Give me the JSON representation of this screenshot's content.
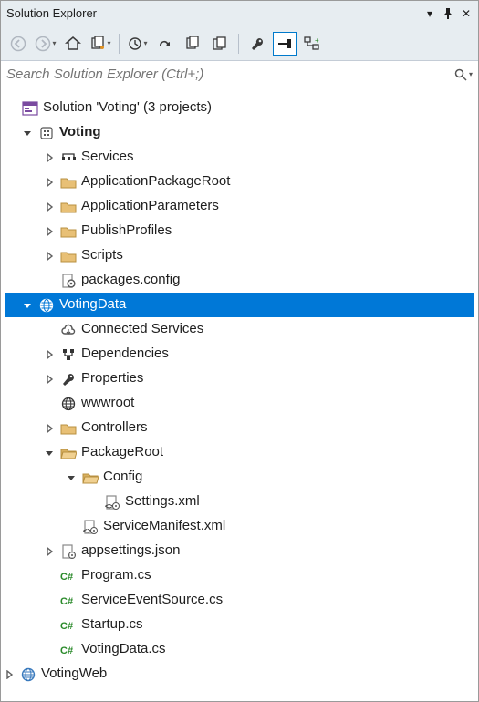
{
  "title": "Solution Explorer",
  "search": {
    "placeholder": "Search Solution Explorer (Ctrl+;)"
  },
  "solution_line": "Solution 'Voting' (3 projects)",
  "nodes": [
    {
      "indent": 0,
      "arrow": "down",
      "icon": "sf-project",
      "label": "Voting",
      "bold": true
    },
    {
      "indent": 24,
      "arrow": "right",
      "icon": "services",
      "label": "Services"
    },
    {
      "indent": 24,
      "arrow": "right",
      "icon": "folder",
      "label": "ApplicationPackageRoot"
    },
    {
      "indent": 24,
      "arrow": "right",
      "icon": "folder",
      "label": "ApplicationParameters"
    },
    {
      "indent": 24,
      "arrow": "right",
      "icon": "folder",
      "label": "PublishProfiles"
    },
    {
      "indent": 24,
      "arrow": "right",
      "icon": "folder",
      "label": "Scripts"
    },
    {
      "indent": 24,
      "arrow": "none",
      "icon": "config",
      "label": "packages.config"
    },
    {
      "indent": 0,
      "arrow": "down",
      "icon": "web-project",
      "label": "VotingData",
      "selected": true
    },
    {
      "indent": 24,
      "arrow": "none",
      "icon": "cloud",
      "label": "Connected Services"
    },
    {
      "indent": 24,
      "arrow": "right",
      "icon": "deps",
      "label": "Dependencies"
    },
    {
      "indent": 24,
      "arrow": "right",
      "icon": "wrench",
      "label": "Properties"
    },
    {
      "indent": 24,
      "arrow": "none",
      "icon": "globe",
      "label": "wwwroot"
    },
    {
      "indent": 24,
      "arrow": "right",
      "icon": "folder",
      "label": "Controllers"
    },
    {
      "indent": 24,
      "arrow": "down",
      "icon": "folder-open",
      "label": "PackageRoot"
    },
    {
      "indent": 48,
      "arrow": "down",
      "icon": "folder-open",
      "label": "Config"
    },
    {
      "indent": 72,
      "arrow": "none",
      "icon": "xml",
      "label": "Settings.xml"
    },
    {
      "indent": 48,
      "arrow": "none",
      "icon": "xml",
      "label": "ServiceManifest.xml"
    },
    {
      "indent": 24,
      "arrow": "right",
      "icon": "json",
      "label": "appsettings.json"
    },
    {
      "indent": 24,
      "arrow": "none",
      "icon": "cs",
      "label": "Program.cs"
    },
    {
      "indent": 24,
      "arrow": "none",
      "icon": "cs",
      "label": "ServiceEventSource.cs"
    },
    {
      "indent": 24,
      "arrow": "none",
      "icon": "cs",
      "label": "Startup.cs"
    },
    {
      "indent": 24,
      "arrow": "none",
      "icon": "cs",
      "label": "VotingData.cs"
    },
    {
      "indent": -24,
      "arrow": "right",
      "icon": "web-project",
      "label": "VotingWeb"
    }
  ]
}
